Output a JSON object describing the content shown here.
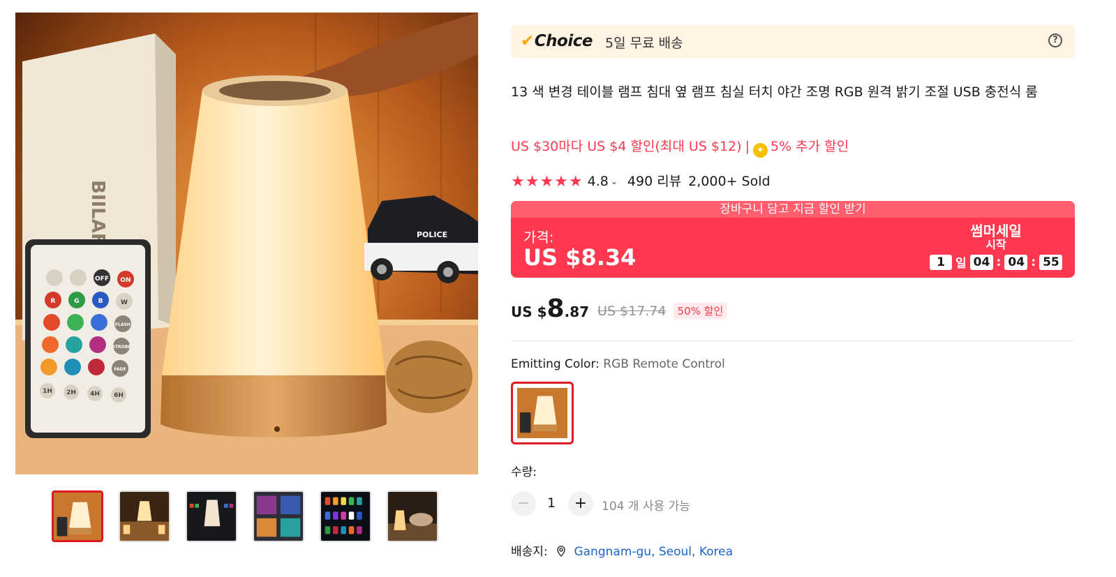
{
  "choice": {
    "logo": "Choice",
    "shipping": "5일 무료 배송"
  },
  "product": {
    "title": "13 색 변경 테이블 램프 침대 옆 램프 침실 터치 야간 조명 RGB 원격 밝기 조절 USB 충전식 룸"
  },
  "promo": {
    "coupon": "US $30마다 US $4 할인(최대 US $12)",
    "separator": "|",
    "extra": "5% 추가 할인"
  },
  "rating": {
    "stars": "★★★★★",
    "score": "4.8",
    "reviews": "490 리뷰",
    "sold": "2,000+ Sold"
  },
  "deal": {
    "banner": "장바구니 담고 지금 할인 받기",
    "price_label": "가격:",
    "price": "US $8.34",
    "title": "썸머세일",
    "subtitle": "시작",
    "countdown": {
      "days": "1",
      "day_label": "일",
      "hours": "04",
      "minutes": "04",
      "seconds": "55"
    }
  },
  "price": {
    "currency": "US $",
    "whole": "8",
    "cents": ".87",
    "original": "US $17.74",
    "discount": "50% 할인"
  },
  "variant": {
    "label": "Emitting Color:",
    "value": "RGB Remote Control"
  },
  "quantity": {
    "label": "수량:",
    "minus": "−",
    "value": "1",
    "plus": "+",
    "available": "104 개 사용 가능"
  },
  "shipping": {
    "label": "배송지:",
    "location": "Gangnam-gu, Seoul, Korea"
  },
  "gallery": {
    "main_image": "night-lamp-photo",
    "remote_buttons": [
      "OFF",
      "ON",
      "R",
      "G",
      "B",
      "W",
      "FLASH",
      "STROBE",
      "FADE",
      "1H",
      "2H",
      "4H",
      "6H"
    ],
    "box_brand": "BIILAFLOR",
    "car_label": "POLICE"
  },
  "colors": {
    "accent": "#fd384f",
    "choice_bg": "#fff4e3",
    "link": "#1a64c8",
    "active_border": "#e0181f"
  }
}
